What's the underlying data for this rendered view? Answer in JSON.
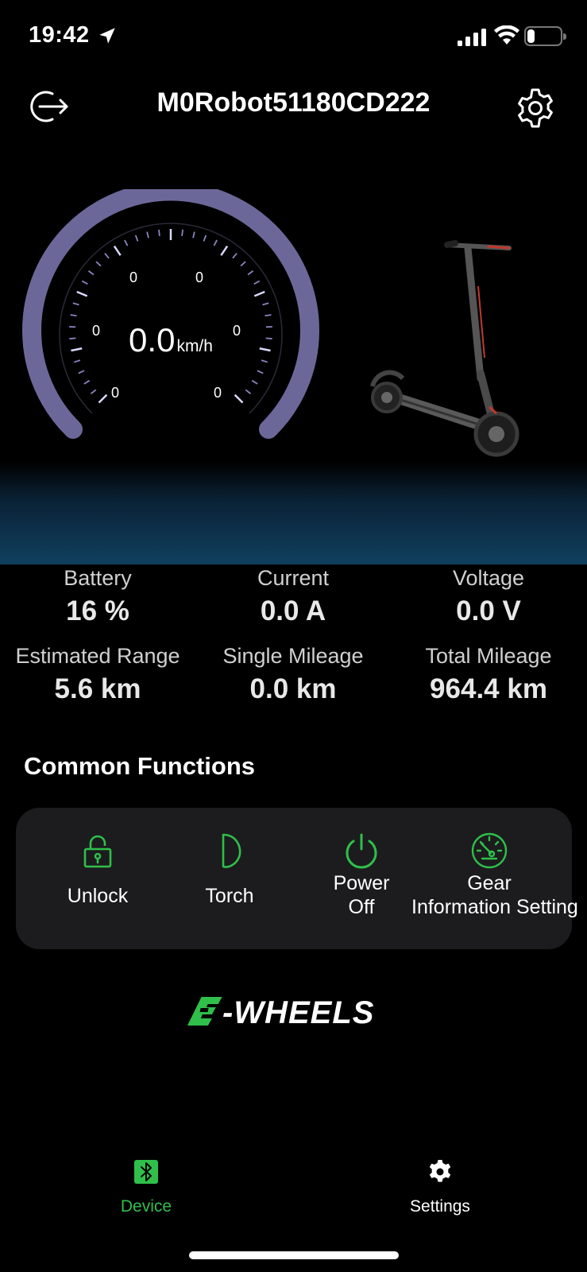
{
  "status_bar": {
    "time": "19:42",
    "battery_level": "22",
    "battery_fraction": 0.22
  },
  "header": {
    "title": "M0Robot51180CD222",
    "logout_icon": "logout-icon",
    "settings_icon": "gear-icon"
  },
  "speedometer": {
    "speed": "0.0",
    "unit": "km/h",
    "scale_labels": [
      "0",
      "0",
      "0",
      "0",
      "0",
      "0"
    ]
  },
  "stats": {
    "battery": {
      "label": "Battery",
      "value": "16 %"
    },
    "current": {
      "label": "Current",
      "value": "0.0 A"
    },
    "voltage": {
      "label": "Voltage",
      "value": "0.0 V"
    },
    "range": {
      "label": "Estimated Range",
      "value": "5.6 km"
    },
    "single_mileage": {
      "label": "Single Mileage",
      "value": "0.0 km"
    },
    "total_mileage": {
      "label": "Total Mileage",
      "value": "964.4 km"
    }
  },
  "common_functions": {
    "title": "Common Functions",
    "items": [
      {
        "label": "Unlock",
        "icon": "unlock-icon"
      },
      {
        "label": "Torch",
        "icon": "torch-icon"
      },
      {
        "label_line1": "Power",
        "label_line2": "Off",
        "icon": "power-icon"
      },
      {
        "label_line1": "Gear",
        "label_line2": "Information Setting",
        "icon": "gauge-icon"
      }
    ]
  },
  "brand": {
    "name": "E-WHEELS"
  },
  "tabs": [
    {
      "label": "Device",
      "icon": "bluetooth-icon",
      "active": true
    },
    {
      "label": "Settings",
      "icon": "gear-icon",
      "active": false
    }
  ],
  "colors": {
    "accent_green": "#2fbf4a",
    "gauge_ring": "#6b6899",
    "panel_bg": "#1c1c1e",
    "dashboard_glow": "#10405f"
  }
}
